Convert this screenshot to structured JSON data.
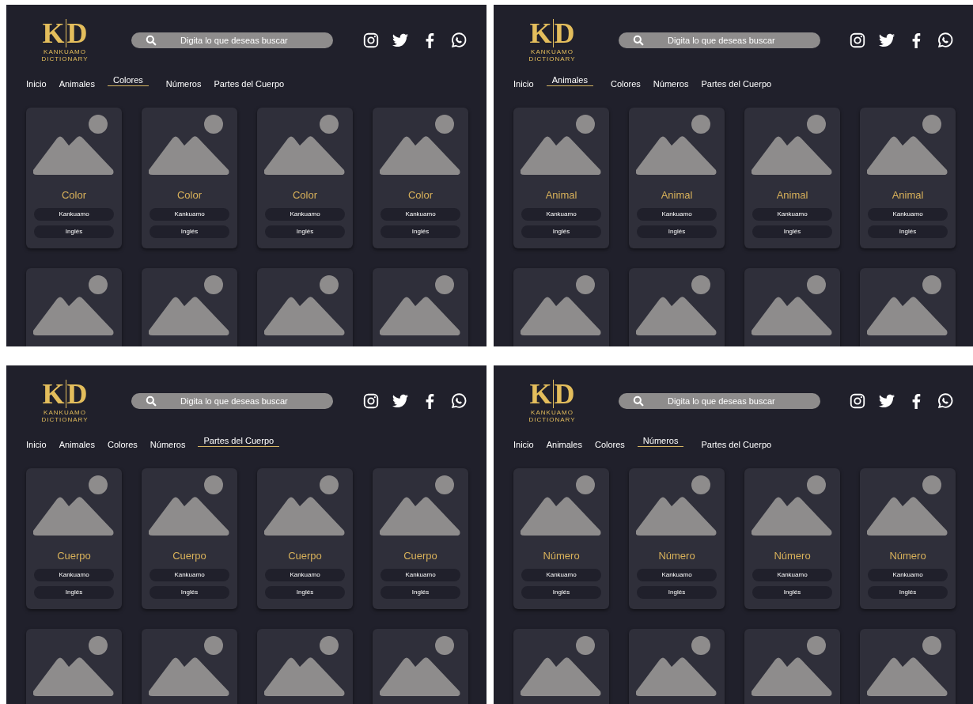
{
  "panels": [
    {
      "logo": {
        "letters": [
          "K",
          "D"
        ],
        "lines": [
          "KANKUAMO",
          "DICTIONARY"
        ]
      },
      "search": {
        "placeholder": "Digita lo que deseas buscar"
      },
      "nav": [
        {
          "label": "Inicio",
          "selected": false
        },
        {
          "label": "Animales",
          "selected": false
        },
        {
          "label": "Colores",
          "selected": true
        },
        {
          "label": "Números",
          "selected": false
        },
        {
          "label": "Partes del Cuerpo",
          "selected": false
        }
      ],
      "cards": [
        {
          "kind": "full",
          "title": "Color",
          "kankuamo": "Kankuamo",
          "english": "Inglés"
        },
        {
          "kind": "full",
          "title": "Color",
          "kankuamo": "Kankuamo",
          "english": "Inglés"
        },
        {
          "kind": "full",
          "title": "Color",
          "kankuamo": "Kankuamo",
          "english": "Inglés"
        },
        {
          "kind": "full",
          "title": "Color",
          "kankuamo": "Kankuamo",
          "english": "Inglés"
        },
        {
          "kind": "cut"
        },
        {
          "kind": "cut"
        },
        {
          "kind": "cut"
        },
        {
          "kind": "cut"
        }
      ]
    },
    {
      "logo": {
        "letters": [
          "K",
          "D"
        ],
        "lines": [
          "KANKUAMO",
          "DICTIONARY"
        ]
      },
      "search": {
        "placeholder": "Digita lo que deseas buscar"
      },
      "nav": [
        {
          "label": "Inicio",
          "selected": false
        },
        {
          "label": "Animales",
          "selected": true
        },
        {
          "label": "Colores",
          "selected": false
        },
        {
          "label": "Números",
          "selected": false
        },
        {
          "label": "Partes del Cuerpo",
          "selected": false
        }
      ],
      "cards": [
        {
          "kind": "full",
          "title": "Animal",
          "kankuamo": "Kankuamo",
          "english": "Inglés"
        },
        {
          "kind": "full",
          "title": "Animal",
          "kankuamo": "Kankuamo",
          "english": "Inglés"
        },
        {
          "kind": "full",
          "title": "Animal",
          "kankuamo": "Kankuamo",
          "english": "Inglés"
        },
        {
          "kind": "full",
          "title": "Animal",
          "kankuamo": "Kankuamo",
          "english": "Inglés"
        },
        {
          "kind": "cut"
        },
        {
          "kind": "cut"
        },
        {
          "kind": "cut"
        },
        {
          "kind": "cut"
        }
      ]
    },
    {
      "logo": {
        "letters": [
          "K",
          "D"
        ],
        "lines": [
          "KANKUAMO",
          "DICTIONARY"
        ]
      },
      "search": {
        "placeholder": "Digita lo que deseas buscar"
      },
      "nav": [
        {
          "label": "Inicio",
          "selected": false
        },
        {
          "label": "Animales",
          "selected": false
        },
        {
          "label": "Colores",
          "selected": false
        },
        {
          "label": "Números",
          "selected": false
        },
        {
          "label": "Partes del Cuerpo",
          "selected": true
        }
      ],
      "cards": [
        {
          "kind": "full",
          "title": "Cuerpo",
          "kankuamo": "Kankuamo",
          "english": "Inglés"
        },
        {
          "kind": "full",
          "title": "Cuerpo",
          "kankuamo": "Kankuamo",
          "english": "Inglés"
        },
        {
          "kind": "full",
          "title": "Cuerpo",
          "kankuamo": "Kankuamo",
          "english": "Inglés"
        },
        {
          "kind": "full",
          "title": "Cuerpo",
          "kankuamo": "Kankuamo",
          "english": "Inglés"
        },
        {
          "kind": "cut"
        },
        {
          "kind": "cut"
        },
        {
          "kind": "cut"
        },
        {
          "kind": "cut"
        }
      ]
    },
    {
      "logo": {
        "letters": [
          "K",
          "D"
        ],
        "lines": [
          "KANKUAMO",
          "DICTIONARY"
        ]
      },
      "search": {
        "placeholder": "Digita lo que deseas buscar"
      },
      "nav": [
        {
          "label": "Inicio",
          "selected": false
        },
        {
          "label": "Animales",
          "selected": false
        },
        {
          "label": "Colores",
          "selected": false
        },
        {
          "label": "Números",
          "selected": true
        },
        {
          "label": "Partes del Cuerpo",
          "selected": false
        }
      ],
      "cards": [
        {
          "kind": "full",
          "title": "Número",
          "kankuamo": "Kankuamo",
          "english": "Inglés"
        },
        {
          "kind": "full",
          "title": "Número",
          "kankuamo": "Kankuamo",
          "english": "Inglés"
        },
        {
          "kind": "full",
          "title": "Número",
          "kankuamo": "Kankuamo",
          "english": "Inglés"
        },
        {
          "kind": "full",
          "title": "Número",
          "kankuamo": "Kankuamo",
          "english": "Inglés"
        },
        {
          "kind": "cut"
        },
        {
          "kind": "cut"
        },
        {
          "kind": "cut"
        },
        {
          "kind": "cut"
        }
      ]
    }
  ]
}
